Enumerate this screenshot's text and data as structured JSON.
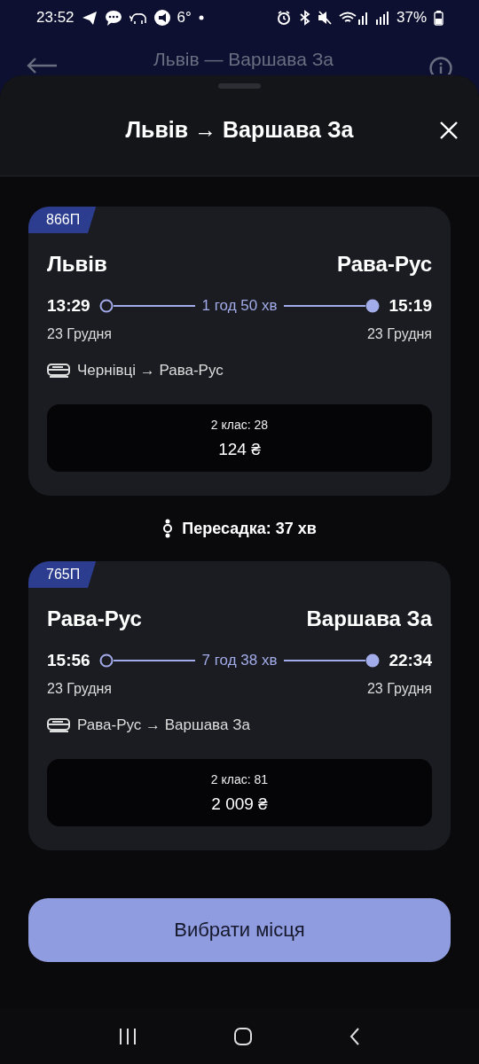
{
  "status_bar": {
    "time": "23:52",
    "temperature": "6°",
    "battery": "37%"
  },
  "app_bar": {
    "title": "Львів — Варшава За"
  },
  "sheet": {
    "title": "Львів → Варшава За"
  },
  "journey": [
    {
      "kind": "segment",
      "train": "866П",
      "from": "Львів",
      "to": "Рава-Рус",
      "departure_time": "13:29",
      "duration": "1 год 50 хв",
      "arrival_time": "15:19",
      "departure_date": "23 Грудня",
      "arrival_date": "23 Грудня",
      "route": "Чернівці → Рава-Рус",
      "seat_class": "2 клас: 28",
      "price": "124 ₴"
    },
    {
      "kind": "transfer",
      "text": "Пересадка: 37 хв"
    },
    {
      "kind": "segment",
      "train": "765П",
      "from": "Рава-Рус",
      "to": "Варшава За",
      "departure_time": "15:56",
      "duration": "7 год 38 хв",
      "arrival_time": "22:34",
      "departure_date": "23 Грудня",
      "arrival_date": "23 Грудня",
      "route": "Рава-Рус → Варшава За",
      "seat_class": "2 клас: 81",
      "price": "2 009 ₴"
    }
  ],
  "button": "Вибрати місця"
}
